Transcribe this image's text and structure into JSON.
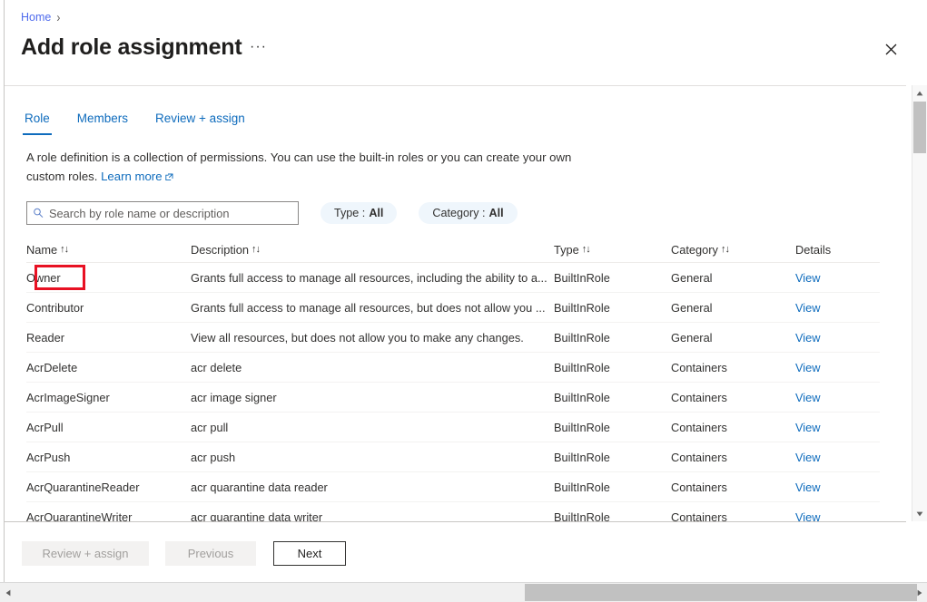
{
  "breadcrumb": {
    "home": "Home",
    "separator": "›"
  },
  "header": {
    "title": "Add role assignment",
    "ellipsis": "···",
    "close_label": "Close"
  },
  "tabs": [
    {
      "label": "Role",
      "selected": true
    },
    {
      "label": "Members",
      "selected": false
    },
    {
      "label": "Review + assign",
      "selected": false
    }
  ],
  "description": {
    "text": "A role definition is a collection of permissions. You can use the built-in roles or you can create your own custom roles.",
    "link": "Learn more"
  },
  "filters": {
    "search_placeholder": "Search by role name or description",
    "search_value": "",
    "type_pill_label": "Type :",
    "type_pill_value": "All",
    "category_pill_label": "Category :",
    "category_pill_value": "All"
  },
  "table": {
    "columns": [
      {
        "label": "Name",
        "sortable": true
      },
      {
        "label": "Description",
        "sortable": true
      },
      {
        "label": "Type",
        "sortable": true
      },
      {
        "label": "Category",
        "sortable": true
      },
      {
        "label": "Details",
        "sortable": false
      }
    ],
    "sort_glyph": "↑↓",
    "rows": [
      {
        "name": "Owner",
        "description": "Grants full access to manage all resources, including the ability to a...",
        "type": "BuiltInRole",
        "category": "General",
        "details": "View",
        "highlighted": true
      },
      {
        "name": "Contributor",
        "description": "Grants full access to manage all resources, but does not allow you ...",
        "type": "BuiltInRole",
        "category": "General",
        "details": "View",
        "highlighted": false
      },
      {
        "name": "Reader",
        "description": "View all resources, but does not allow you to make any changes.",
        "type": "BuiltInRole",
        "category": "General",
        "details": "View",
        "highlighted": false
      },
      {
        "name": "AcrDelete",
        "description": "acr delete",
        "type": "BuiltInRole",
        "category": "Containers",
        "details": "View",
        "highlighted": false
      },
      {
        "name": "AcrImageSigner",
        "description": "acr image signer",
        "type": "BuiltInRole",
        "category": "Containers",
        "details": "View",
        "highlighted": false
      },
      {
        "name": "AcrPull",
        "description": "acr pull",
        "type": "BuiltInRole",
        "category": "Containers",
        "details": "View",
        "highlighted": false
      },
      {
        "name": "AcrPush",
        "description": "acr push",
        "type": "BuiltInRole",
        "category": "Containers",
        "details": "View",
        "highlighted": false
      },
      {
        "name": "AcrQuarantineReader",
        "description": "acr quarantine data reader",
        "type": "BuiltInRole",
        "category": "Containers",
        "details": "View",
        "highlighted": false
      },
      {
        "name": "AcrQuarantineWriter",
        "description": "acr quarantine data writer",
        "type": "BuiltInRole",
        "category": "Containers",
        "details": "View",
        "highlighted": false
      }
    ]
  },
  "footer": {
    "review_label": "Review + assign",
    "review_disabled": true,
    "previous_label": "Previous",
    "previous_disabled": true,
    "next_label": "Next",
    "next_disabled": false
  },
  "colors": {
    "link": "#0f6cbd",
    "breadcrumb_link": "#4f6bed",
    "pill_bg": "#eff6fc",
    "annotation": "#e81123",
    "text": "#323130"
  }
}
